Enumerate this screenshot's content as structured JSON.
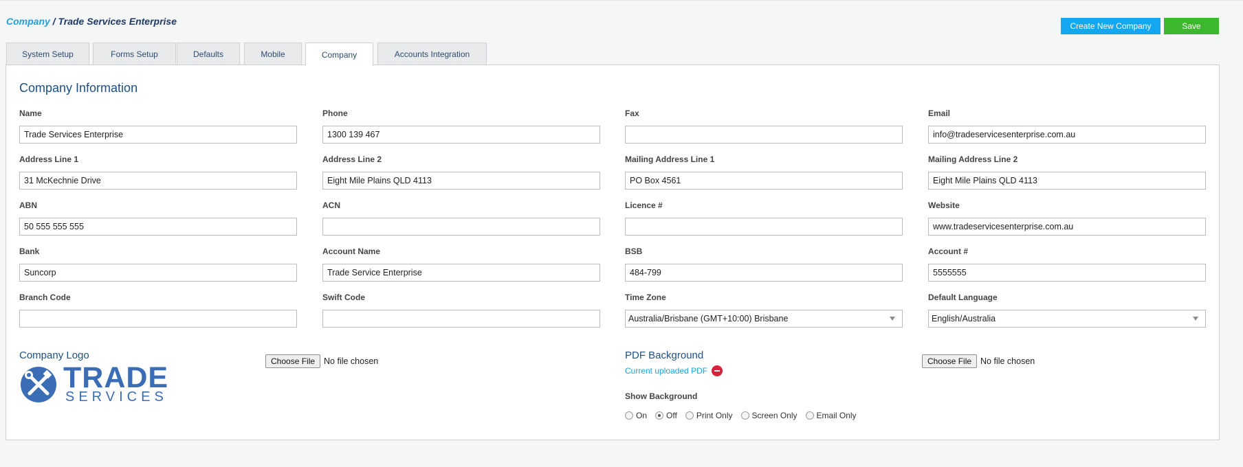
{
  "breadcrumb": {
    "parent": "Company",
    "separator": " / ",
    "current": "Trade Services Enterprise"
  },
  "actions": {
    "create_label": "Create New Company",
    "save_label": "Save"
  },
  "tabs": [
    {
      "label": "System Setup",
      "active": false
    },
    {
      "label": "Forms Setup",
      "active": false
    },
    {
      "label": "Defaults",
      "active": false
    },
    {
      "label": "Mobile",
      "active": false
    },
    {
      "label": "Company",
      "active": true
    },
    {
      "label": "Accounts Integration",
      "active": false
    }
  ],
  "panel": {
    "title": "Company Information"
  },
  "fields": {
    "name": {
      "label": "Name",
      "value": "Trade Services Enterprise"
    },
    "phone": {
      "label": "Phone",
      "value": "1300 139 467"
    },
    "fax": {
      "label": "Fax",
      "value": ""
    },
    "email": {
      "label": "Email",
      "value": "info@tradeservicesenterprise.com.au"
    },
    "address1": {
      "label": "Address Line 1",
      "value": "31 McKechnie Drive"
    },
    "address2": {
      "label": "Address Line 2",
      "value": "Eight Mile Plains QLD 4113"
    },
    "mailing1": {
      "label": "Mailing Address Line 1",
      "value": "PO Box 4561"
    },
    "mailing2": {
      "label": "Mailing Address Line 2",
      "value": "Eight Mile Plains QLD 4113"
    },
    "abn": {
      "label": "ABN",
      "value": "50 555 555 555"
    },
    "acn": {
      "label": "ACN",
      "value": ""
    },
    "licence": {
      "label": "Licence #",
      "value": ""
    },
    "website": {
      "label": "Website",
      "value": "www.tradeservicesenterprise.com.au"
    },
    "bank": {
      "label": "Bank",
      "value": "Suncorp"
    },
    "account_name": {
      "label": "Account Name",
      "value": "Trade Service Enterprise"
    },
    "bsb": {
      "label": "BSB",
      "value": "484-799"
    },
    "account_number": {
      "label": "Account #",
      "value": "5555555"
    },
    "branch_code": {
      "label": "Branch Code",
      "value": ""
    },
    "swift_code": {
      "label": "Swift Code",
      "value": ""
    },
    "time_zone": {
      "label": "Time Zone",
      "value": "Australia/Brisbane (GMT+10:00) Brisbane"
    },
    "default_language": {
      "label": "Default Language",
      "value": "English/Australia"
    }
  },
  "logo_section": {
    "title": "Company Logo",
    "logo_text_top": "TRADE",
    "logo_text_bottom": "SERVICES",
    "logo_color": "#3a6db5",
    "file_button": "Choose File",
    "file_status": "No file chosen"
  },
  "pdf_section": {
    "title": "PDF Background",
    "current_link": "Current uploaded PDF",
    "file_button": "Choose File",
    "file_status": "No file chosen",
    "show_background_label": "Show Background",
    "options": [
      {
        "label": "On",
        "checked": false
      },
      {
        "label": "Off",
        "checked": true
      },
      {
        "label": "Print Only",
        "checked": false
      },
      {
        "label": "Screen Only",
        "checked": false
      },
      {
        "label": "Email Only",
        "checked": false
      }
    ]
  },
  "colors": {
    "accent_blue": "#14a6ee",
    "save_green": "#3cb72e",
    "title_navy": "#1f4e82",
    "remove_red": "#d8213a"
  }
}
